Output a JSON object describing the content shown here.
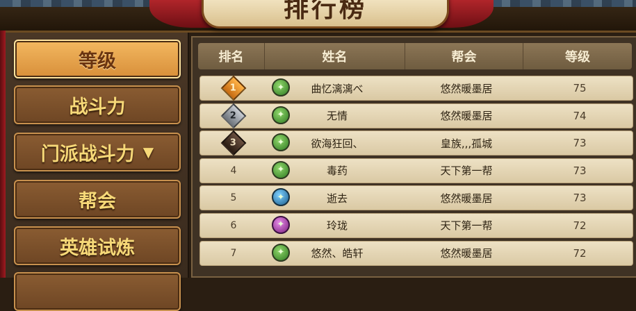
{
  "title": "排行榜",
  "sidebar": {
    "items": [
      {
        "label": "等级",
        "active": true,
        "dropdown": false
      },
      {
        "label": "战斗力",
        "active": false,
        "dropdown": false
      },
      {
        "label": "门派战斗力",
        "active": false,
        "dropdown": true,
        "dropdown_glyph": "▼"
      },
      {
        "label": "帮会",
        "active": false,
        "dropdown": false
      },
      {
        "label": "英雄试炼",
        "active": false,
        "dropdown": false
      }
    ]
  },
  "table": {
    "headers": {
      "rank": "排名",
      "name": "姓名",
      "guild": "帮会",
      "level": "等级"
    },
    "rows": [
      {
        "rank": "1",
        "medal": "gold",
        "class_icon": "green-class-icon",
        "name": "曲忆漓漓べ",
        "guild": "悠然暖墨居",
        "level": "75"
      },
      {
        "rank": "2",
        "medal": "silver",
        "class_icon": "green-class-icon",
        "name": "无情",
        "guild": "悠然暖墨居",
        "level": "74"
      },
      {
        "rank": "3",
        "medal": "bronze",
        "class_icon": "green-class-icon",
        "name": "欲海狂回、",
        "guild": "皇族,,,孤城",
        "level": "73"
      },
      {
        "rank": "4",
        "medal": "",
        "class_icon": "green-class-icon",
        "name": "毒药",
        "guild": "天下第一帮",
        "level": "73"
      },
      {
        "rank": "5",
        "medal": "",
        "class_icon": "blue-class-icon",
        "name": "逝去",
        "guild": "悠然暖墨居",
        "level": "73"
      },
      {
        "rank": "6",
        "medal": "",
        "class_icon": "purple-class-icon",
        "name": "玲珑",
        "guild": "天下第一帮",
        "level": "72"
      },
      {
        "rank": "7",
        "medal": "",
        "class_icon": "green-class-icon",
        "name": "悠然、皓轩",
        "guild": "悠然暖墨居",
        "level": "72"
      }
    ]
  },
  "colors": {
    "accent": "#f7d978",
    "active_button": "#e3a24c",
    "row_bg": "#e6d8b8"
  }
}
